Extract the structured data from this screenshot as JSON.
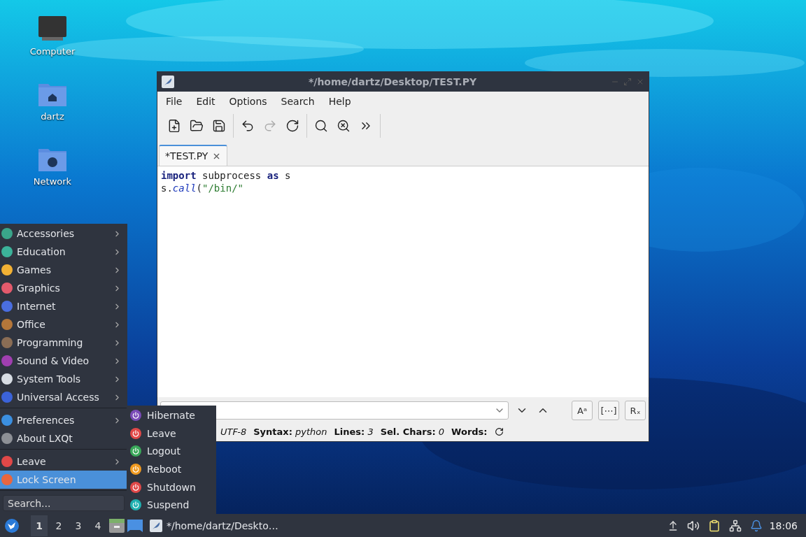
{
  "desktop_icons": [
    {
      "label": "Computer",
      "kind": "computer"
    },
    {
      "label": "dartz",
      "kind": "home"
    },
    {
      "label": "Network",
      "kind": "network"
    }
  ],
  "editor": {
    "title": "*/home/dartz/Desktop/TEST.PY",
    "menu": [
      "File",
      "Edit",
      "Options",
      "Search",
      "Help"
    ],
    "toolbar": [
      [
        {
          "kind": "new",
          "disabled": false
        },
        {
          "kind": "open",
          "disabled": false
        },
        {
          "kind": "save",
          "disabled": false
        }
      ],
      [
        {
          "kind": "undo",
          "disabled": false
        },
        {
          "kind": "redo",
          "disabled": true
        },
        {
          "kind": "reload",
          "disabled": false
        }
      ],
      [
        {
          "kind": "find",
          "disabled": false
        },
        {
          "kind": "replace",
          "disabled": false
        },
        {
          "kind": "more",
          "disabled": false
        }
      ]
    ],
    "tabs": [
      {
        "label": "*TEST.PY",
        "selected": true
      }
    ],
    "code": [
      [
        {
          "kind": "keyword",
          "text": "import"
        },
        {
          "kind": "plain",
          "text": " subprocess "
        },
        {
          "kind": "keyword",
          "text": "as"
        },
        {
          "kind": "plain",
          "text": " s"
        }
      ],
      [
        {
          "kind": "plain",
          "text": "s."
        },
        {
          "kind": "function",
          "text": "call"
        },
        {
          "kind": "plain",
          "text": "("
        },
        {
          "kind": "string",
          "text": "\"/bin/\""
        }
      ]
    ],
    "find_options": [
      "Aᵃ",
      "[⋯]",
      "Rₓ"
    ],
    "status_bar": [
      {
        "value": "UTF-8"
      },
      {
        "label": "Syntax:",
        "value": "python"
      },
      {
        "label": "Lines:",
        "value": "3"
      },
      {
        "label": "Sel. Chars:",
        "value": "0"
      },
      {
        "label": "Words:"
      }
    ]
  },
  "start_menu": {
    "sections": [
      [
        {
          "label": "Accessories",
          "submenu": true,
          "selected": false
        },
        {
          "label": "Education",
          "submenu": true,
          "selected": false
        },
        {
          "label": "Games",
          "submenu": true,
          "selected": false
        },
        {
          "label": "Graphics",
          "submenu": true,
          "selected": false
        },
        {
          "label": "Internet",
          "submenu": true,
          "selected": false
        },
        {
          "label": "Office",
          "submenu": true,
          "selected": false
        },
        {
          "label": "Programming",
          "submenu": true,
          "selected": false
        },
        {
          "label": "Sound & Video",
          "submenu": true,
          "selected": false
        },
        {
          "label": "System Tools",
          "submenu": true,
          "selected": false
        },
        {
          "label": "Universal Access",
          "submenu": true,
          "selected": false
        }
      ],
      [
        {
          "label": "Preferences",
          "submenu": true,
          "selected": false
        },
        {
          "label": "About LXQt",
          "submenu": false,
          "selected": false
        }
      ],
      [
        {
          "label": "Leave",
          "submenu": true,
          "selected": false
        },
        {
          "label": "Lock Screen",
          "submenu": false,
          "selected": true
        }
      ]
    ],
    "search_placeholder": "Search..."
  },
  "leave_menu": [
    "Hibernate",
    "Leave",
    "Logout",
    "Reboot",
    "Shutdown",
    "Suspend"
  ],
  "taskbar": {
    "workspaces": [
      {
        "label": "1",
        "selected": true
      },
      {
        "label": "2",
        "selected": false
      },
      {
        "label": "3",
        "selected": false
      },
      {
        "label": "4",
        "selected": false
      }
    ],
    "tasks": [
      {
        "label": "*/home/dartz/Deskto…"
      }
    ],
    "clock": "18:06"
  }
}
